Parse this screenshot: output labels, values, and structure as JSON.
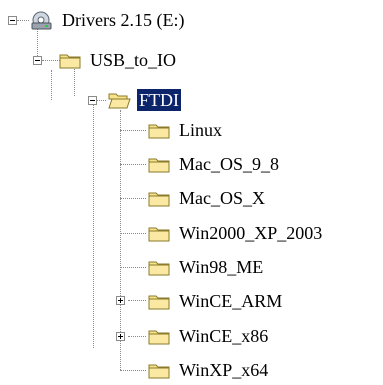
{
  "tree": {
    "root": {
      "label": "Drivers 2.15 (E:)",
      "icon": "drive-icon",
      "expanded": true
    },
    "level1": {
      "label": "USB_to_IO",
      "icon": "folder-icon",
      "expanded": true
    },
    "level2": {
      "label": "FTDI",
      "icon": "open-folder-icon",
      "expanded": true,
      "selected": true
    },
    "children": [
      {
        "label": "Linux",
        "has_children": false
      },
      {
        "label": "Mac_OS_9_8",
        "has_children": false
      },
      {
        "label": "Mac_OS_X",
        "has_children": false
      },
      {
        "label": "Win2000_XP_2003",
        "has_children": false
      },
      {
        "label": "Win98_ME",
        "has_children": false
      },
      {
        "label": "WinCE_ARM",
        "has_children": true
      },
      {
        "label": "WinCE_x86",
        "has_children": true
      },
      {
        "label": "WinXP_x64",
        "has_children": false
      }
    ]
  },
  "colors": {
    "selection_bg": "#0b246a",
    "folder_fill": "#f7e38a",
    "folder_stroke": "#8a7a2a"
  }
}
